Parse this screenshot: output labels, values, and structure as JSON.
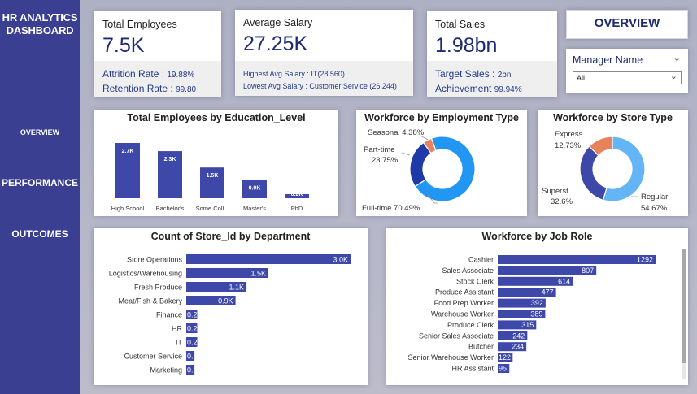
{
  "sidebar": {
    "title_line1": "HR ANALYTICS",
    "title_line2": "DASHBOARD",
    "nav": [
      "OVERVIEW",
      "PERFORMANCE",
      "OUTCOMES"
    ]
  },
  "kpis": {
    "employees": {
      "label": "Total Employees",
      "value": "7.5K",
      "line1_label": "Attrition Rate :",
      "line1_value": "19.88%",
      "line2_label": "Retention Rate :",
      "line2_value": "99.80"
    },
    "salary": {
      "label": "Average Salary",
      "value": "27.25K",
      "line1": "Highest Avg Salary : IT(28,560)",
      "line2": "Lowest Avg Salary : Customer Service (26,244)"
    },
    "sales": {
      "label": "Total Sales",
      "value": "1.98bn",
      "line1_label": "Target Sales :",
      "line1_value": "2bn",
      "line2_label": "Achievement",
      "line2_value": "99.94%"
    }
  },
  "overview_label": "OVERVIEW",
  "manager_filter": {
    "label": "Manager Name",
    "selected": "All"
  },
  "colors": {
    "accent": "#3d48a8",
    "sidebar": "#3a3f92",
    "fulltime": "#2196f3",
    "parttime": "#1f3aa8",
    "seasonal": "#e8825a",
    "regular": "#64b5f6",
    "superstore": "#3d48a8",
    "express": "#e8825a"
  },
  "chart_data": [
    {
      "type": "bar",
      "title": "Total Employees by Education_Level",
      "categories": [
        "High School",
        "Bachelor's",
        "Some Coll...",
        "Master's",
        "PhD"
      ],
      "values": [
        2700,
        2300,
        1500,
        900,
        200
      ],
      "data_labels": [
        "2.7K",
        "2.3K",
        "1.5K",
        "0.9K",
        "0.2K"
      ]
    },
    {
      "type": "pie",
      "title": "Workforce by Employment Type",
      "labels": [
        "Full-time",
        "Part-time",
        "Seasonal"
      ],
      "values": [
        70.49,
        23.75,
        4.38
      ],
      "data_labels": [
        "Full-time 70.49%",
        "Part-time 23.75%",
        "Seasonal 4.38%"
      ]
    },
    {
      "type": "pie",
      "title": "Workforce by Store Type",
      "labels": [
        "Regular",
        "Superst...",
        "Express"
      ],
      "values": [
        54.67,
        32.6,
        12.73
      ],
      "data_labels": [
        "54.67%",
        "32.6%",
        "12.73%"
      ]
    },
    {
      "type": "bar",
      "title": "Count of Store_Id by Department",
      "categories": [
        "Store Operations",
        "Logistics/Warehousing",
        "Fresh Produce",
        "Meat/Fish & Bakery",
        "Finance",
        "HR",
        "IT",
        "Customer Service",
        "Marketing"
      ],
      "values": [
        3000,
        1500,
        1100,
        900,
        200,
        200,
        200,
        150,
        150
      ],
      "data_labels": [
        "3.0K",
        "1.5K",
        "1.1K",
        "0.9K",
        "0.2",
        "0.2",
        "0.2",
        "0.",
        "0."
      ]
    },
    {
      "type": "bar",
      "title": "Workforce by Job Role",
      "categories": [
        "Cashier",
        "Sales Associate",
        "Stock Clerk",
        "Produce Assistant",
        "Food Prep Worker",
        "Warehouse Worker",
        "Produce Clerk",
        "Senior Sales Associate",
        "Butcher",
        "Senior Warehouse Worker",
        "HR Assistant"
      ],
      "values": [
        1292,
        807,
        614,
        477,
        392,
        389,
        315,
        242,
        234,
        122,
        95
      ],
      "data_labels": [
        "1292",
        "807",
        "614",
        "477",
        "392",
        "389",
        "315",
        "242",
        "234",
        "122",
        "95"
      ]
    }
  ]
}
